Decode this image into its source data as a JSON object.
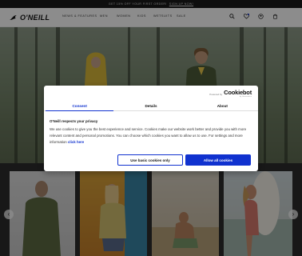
{
  "promo": {
    "text": "GET 15% OFF YOUR FIRST ORDER!",
    "link": "SIGN UP NOW!"
  },
  "header": {
    "logo": "O'NEILL",
    "nav": [
      "NEWS & FEATURES",
      "MEN",
      "WOMEN",
      "KIDS",
      "WETSUITS",
      "SALE"
    ],
    "icons": [
      "search-icon",
      "wishlist-icon",
      "account-icon",
      "cart-icon"
    ]
  },
  "cookie_dialog": {
    "powered_by": "Powered by",
    "brand": "Cookiebot",
    "brand_sub": "by Usercentrics",
    "tabs": [
      "Consent",
      "Details",
      "About"
    ],
    "active_tab": "Consent",
    "title": "O'Neill respects your privacy",
    "body": "We use cookies to give you the best experience and service. Cookies make our website work better and provide you with more relevant content and personal promotions. You can choose which cookies you want to allow us to use. For settings and more information",
    "body_link": "click here",
    "buttons": {
      "basic": "Use basic cookies only",
      "all": "Allow all cookies"
    }
  },
  "colors": {
    "accent": "#1032cf",
    "promo_bg": "#1b1b1b"
  }
}
